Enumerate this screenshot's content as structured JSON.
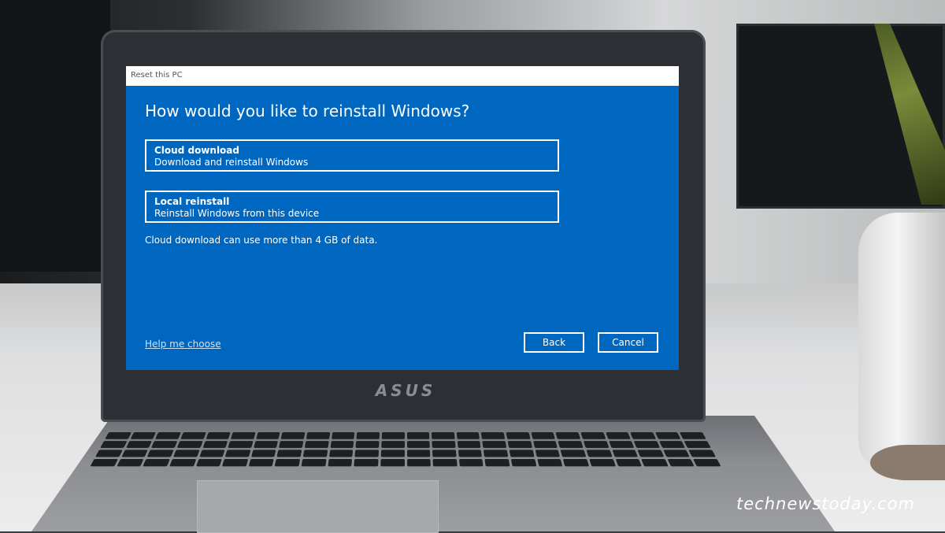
{
  "window": {
    "title": "Reset this PC"
  },
  "dialog": {
    "heading": "How would you like to reinstall Windows?",
    "options": [
      {
        "title": "Cloud download",
        "description": "Download and reinstall Windows"
      },
      {
        "title": "Local reinstall",
        "description": "Reinstall Windows from this device"
      }
    ],
    "info": "Cloud download can use more than 4 GB of data.",
    "help_link": "Help me choose",
    "back_label": "Back",
    "cancel_label": "Cancel"
  },
  "device": {
    "brand_logo": "ASUS"
  },
  "watermark": "technewstoday.com",
  "colors": {
    "dialog_background": "#0067c0",
    "titlebar_background": "#ffffff",
    "text": "#ffffff"
  }
}
